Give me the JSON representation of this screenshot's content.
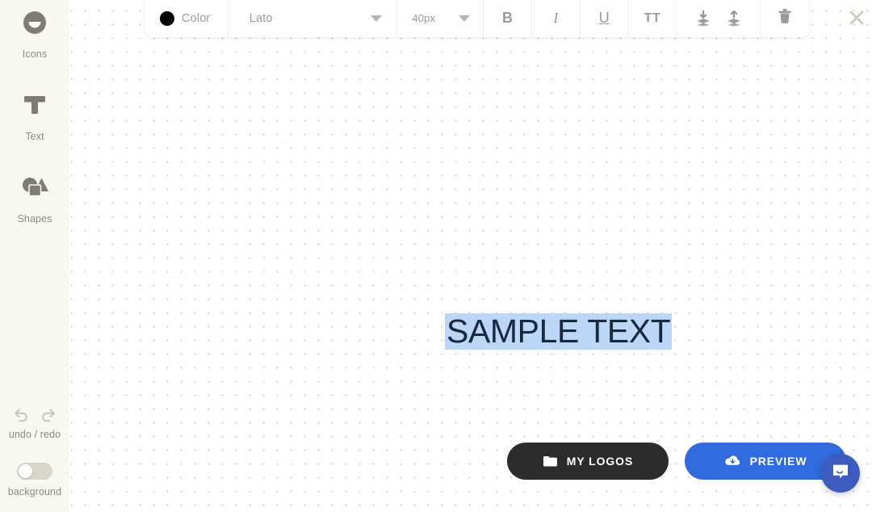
{
  "sidebar": {
    "tools": [
      {
        "label": "Icons",
        "icon": "icons-circle-icon"
      },
      {
        "label": "Text",
        "icon": "text-t-icon"
      },
      {
        "label": "Shapes",
        "icon": "shapes-icon"
      }
    ],
    "undo_redo_label": "undo / redo",
    "undo_icon": "undo-icon",
    "redo_icon": "redo-icon",
    "background_label": "background",
    "background_toggle_state": "off"
  },
  "toolbar": {
    "color_label": "Color",
    "color_value": "#000000",
    "font_family_value": "Lato",
    "font_size_value": "40px",
    "bold_label": "B",
    "italic_label": "I",
    "underline_label": "U",
    "uppercase_label": "TT",
    "send_backward_icon": "send-to-back-icon",
    "bring_forward_icon": "bring-to-front-icon",
    "delete_icon": "trash-icon",
    "dropdown_icon": "chevron-down-icon",
    "close_icon": "close-x-icon"
  },
  "canvas": {
    "text_object": {
      "value": "SAMPLE TEXT",
      "selected": true,
      "selection_color": "#bcd7f5",
      "text_color": "#192a3e",
      "font_size": "40px",
      "font_family": "Lato"
    }
  },
  "footer": {
    "my_logos_label": "MY LOGOS",
    "my_logos_icon": "folder-icon",
    "my_logos_color": "#2c2c2c",
    "preview_label": "PREVIEW",
    "preview_icon": "cloud-download-icon",
    "preview_color": "#2f6bdd"
  },
  "intercom": {
    "icon": "chat-bubble-icon",
    "color": "#3c5bbf"
  }
}
